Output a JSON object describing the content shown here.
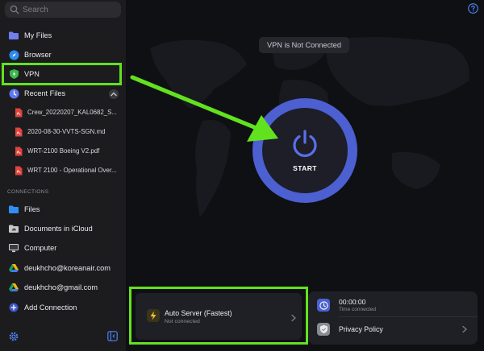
{
  "search": {
    "placeholder": "Search"
  },
  "sidebar": {
    "items": [
      {
        "label": "My Files"
      },
      {
        "label": "Browser"
      },
      {
        "label": "VPN"
      },
      {
        "label": "Recent Files"
      }
    ],
    "recent_files": [
      {
        "label": "Crew_20220207_KAL0682_S..."
      },
      {
        "label": "2020-08-30-VVTS-SGN.md"
      },
      {
        "label": "WRT-2100 Boeing V2.pdf"
      },
      {
        "label": "WRT 2100 - Operational Over..."
      }
    ],
    "connections_header": "CONNECTIONS",
    "connections": [
      {
        "label": "Files"
      },
      {
        "label": "Documents in iCloud"
      },
      {
        "label": "Computer"
      },
      {
        "label": "deukhcho@koreanair.com"
      },
      {
        "label": "deukhcho@gmail.com"
      },
      {
        "label": "Add Connection"
      }
    ]
  },
  "main": {
    "status": "VPN is Not Connected",
    "start_label": "START",
    "server": {
      "title": "Auto Server (Fastest)",
      "subtitle": "Not connected"
    },
    "time": {
      "value": "00:00:00",
      "label": "Time connected"
    },
    "privacy_label": "Privacy Policy"
  },
  "colors": {
    "accent_blue": "#4c60d2",
    "highlight_green": "#62e21f",
    "sidebar_bg": "#1c1c1f",
    "main_bg": "#0f1014"
  }
}
